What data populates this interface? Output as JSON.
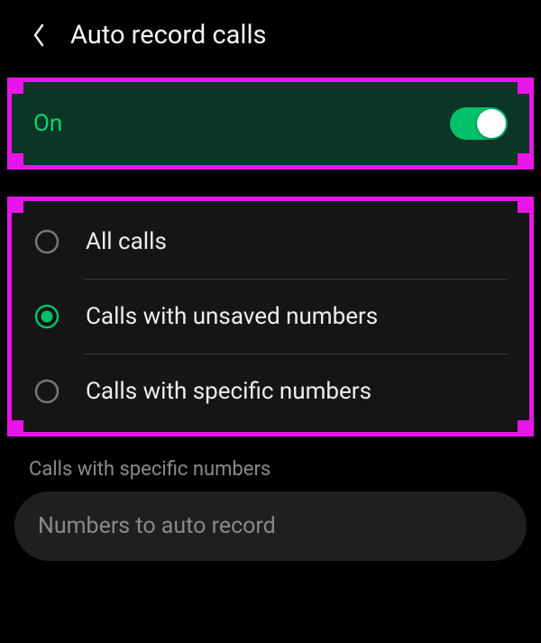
{
  "header": {
    "title": "Auto record calls"
  },
  "toggle": {
    "label": "On",
    "state": true
  },
  "options": {
    "items": [
      {
        "label": "All calls",
        "selected": false
      },
      {
        "label": "Calls with unsaved numbers",
        "selected": true
      },
      {
        "label": "Calls with specific numbers",
        "selected": false
      }
    ]
  },
  "specific": {
    "section_label": "Calls with specific numbers",
    "placeholder": "Numbers to auto record"
  },
  "colors": {
    "highlight": "#e815e8",
    "accent": "#00c069",
    "toggle_bg": "#0b3627"
  }
}
